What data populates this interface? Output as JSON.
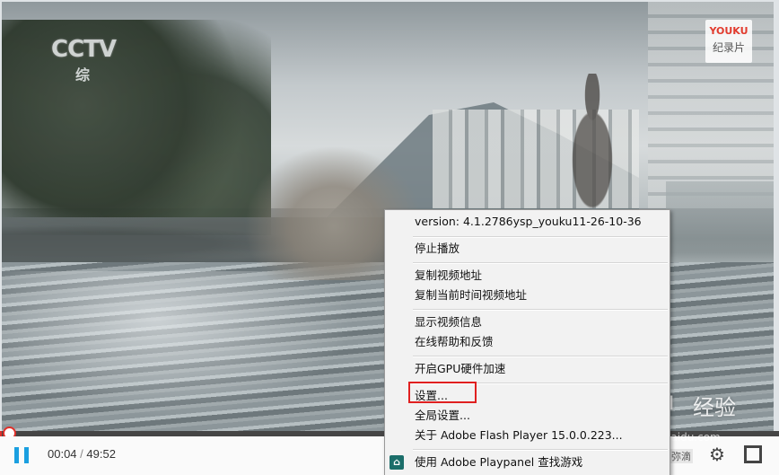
{
  "video": {
    "channel_logo": "CCTV",
    "channel_sub": "综",
    "badge_brand": "YOUKU",
    "badge_sub": "纪录片"
  },
  "player": {
    "progress_fraction": 0.0013,
    "current_time": "00:04",
    "time_separator": "/",
    "duration": "49:52",
    "cc_label": "弥滴",
    "accent_color": "#e0302a",
    "play_color": "#1a9fe0"
  },
  "context_menu": {
    "version": "version: 4.1.2786ysp_youku11-26-10-36",
    "stop": "停止播放",
    "copy_url": "复制视频地址",
    "copy_time_url": "复制当前时间视频地址",
    "show_info": "显示视频信息",
    "help_feedback": "在线帮助和反馈",
    "gpu_accel": "开启GPU硬件加速",
    "settings": "设置...",
    "global_settings": "全局设置...",
    "about_flash": "关于 Adobe Flash Player 15.0.0.223...",
    "playpanel": "使用 Adobe Playpanel 查找游戏",
    "playpanel_icon": "playpanel-icon"
  },
  "watermark": {
    "logo": "Baidu",
    "sub": "经验",
    "url": "jingyan.baidu.com"
  }
}
